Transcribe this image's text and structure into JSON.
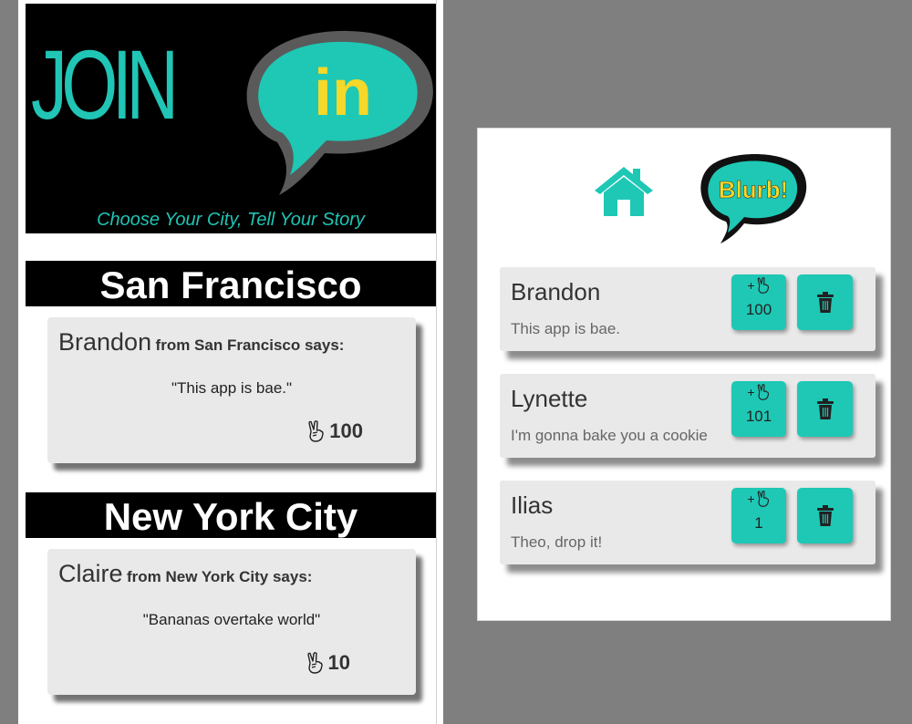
{
  "left_app": {
    "logo": {
      "join_text": "JOIN",
      "bubble_text": "in"
    },
    "tagline": "Choose Your City, Tell Your Story",
    "cities": [
      {
        "name": "San Francisco",
        "post": {
          "author": "Brandon",
          "from": "from San Francisco says:",
          "quote": "\"This app is bae.\"",
          "likes": "100"
        }
      },
      {
        "name": "New York City",
        "post": {
          "author": "Claire",
          "from": "from New York City says:",
          "quote": "\"Bananas overtake world\"",
          "likes": "10"
        }
      }
    ]
  },
  "right_app": {
    "nav": {
      "home_icon": "home-icon",
      "blurb_label": "Blurb!"
    },
    "posts": [
      {
        "author": "Brandon",
        "text": "This app is bae.",
        "like_label": "+",
        "likes": "100"
      },
      {
        "author": "Lynette",
        "text": "I'm gonna bake you a cookie",
        "like_label": "+",
        "likes": "101"
      },
      {
        "author": "Ilias",
        "text": "Theo, drop it!",
        "like_label": "+",
        "likes": "1"
      }
    ]
  },
  "colors": {
    "teal": "#1ec8b5",
    "yellow": "#f5d829",
    "card": "#e9e9e9",
    "dark_gray": "#555555"
  }
}
